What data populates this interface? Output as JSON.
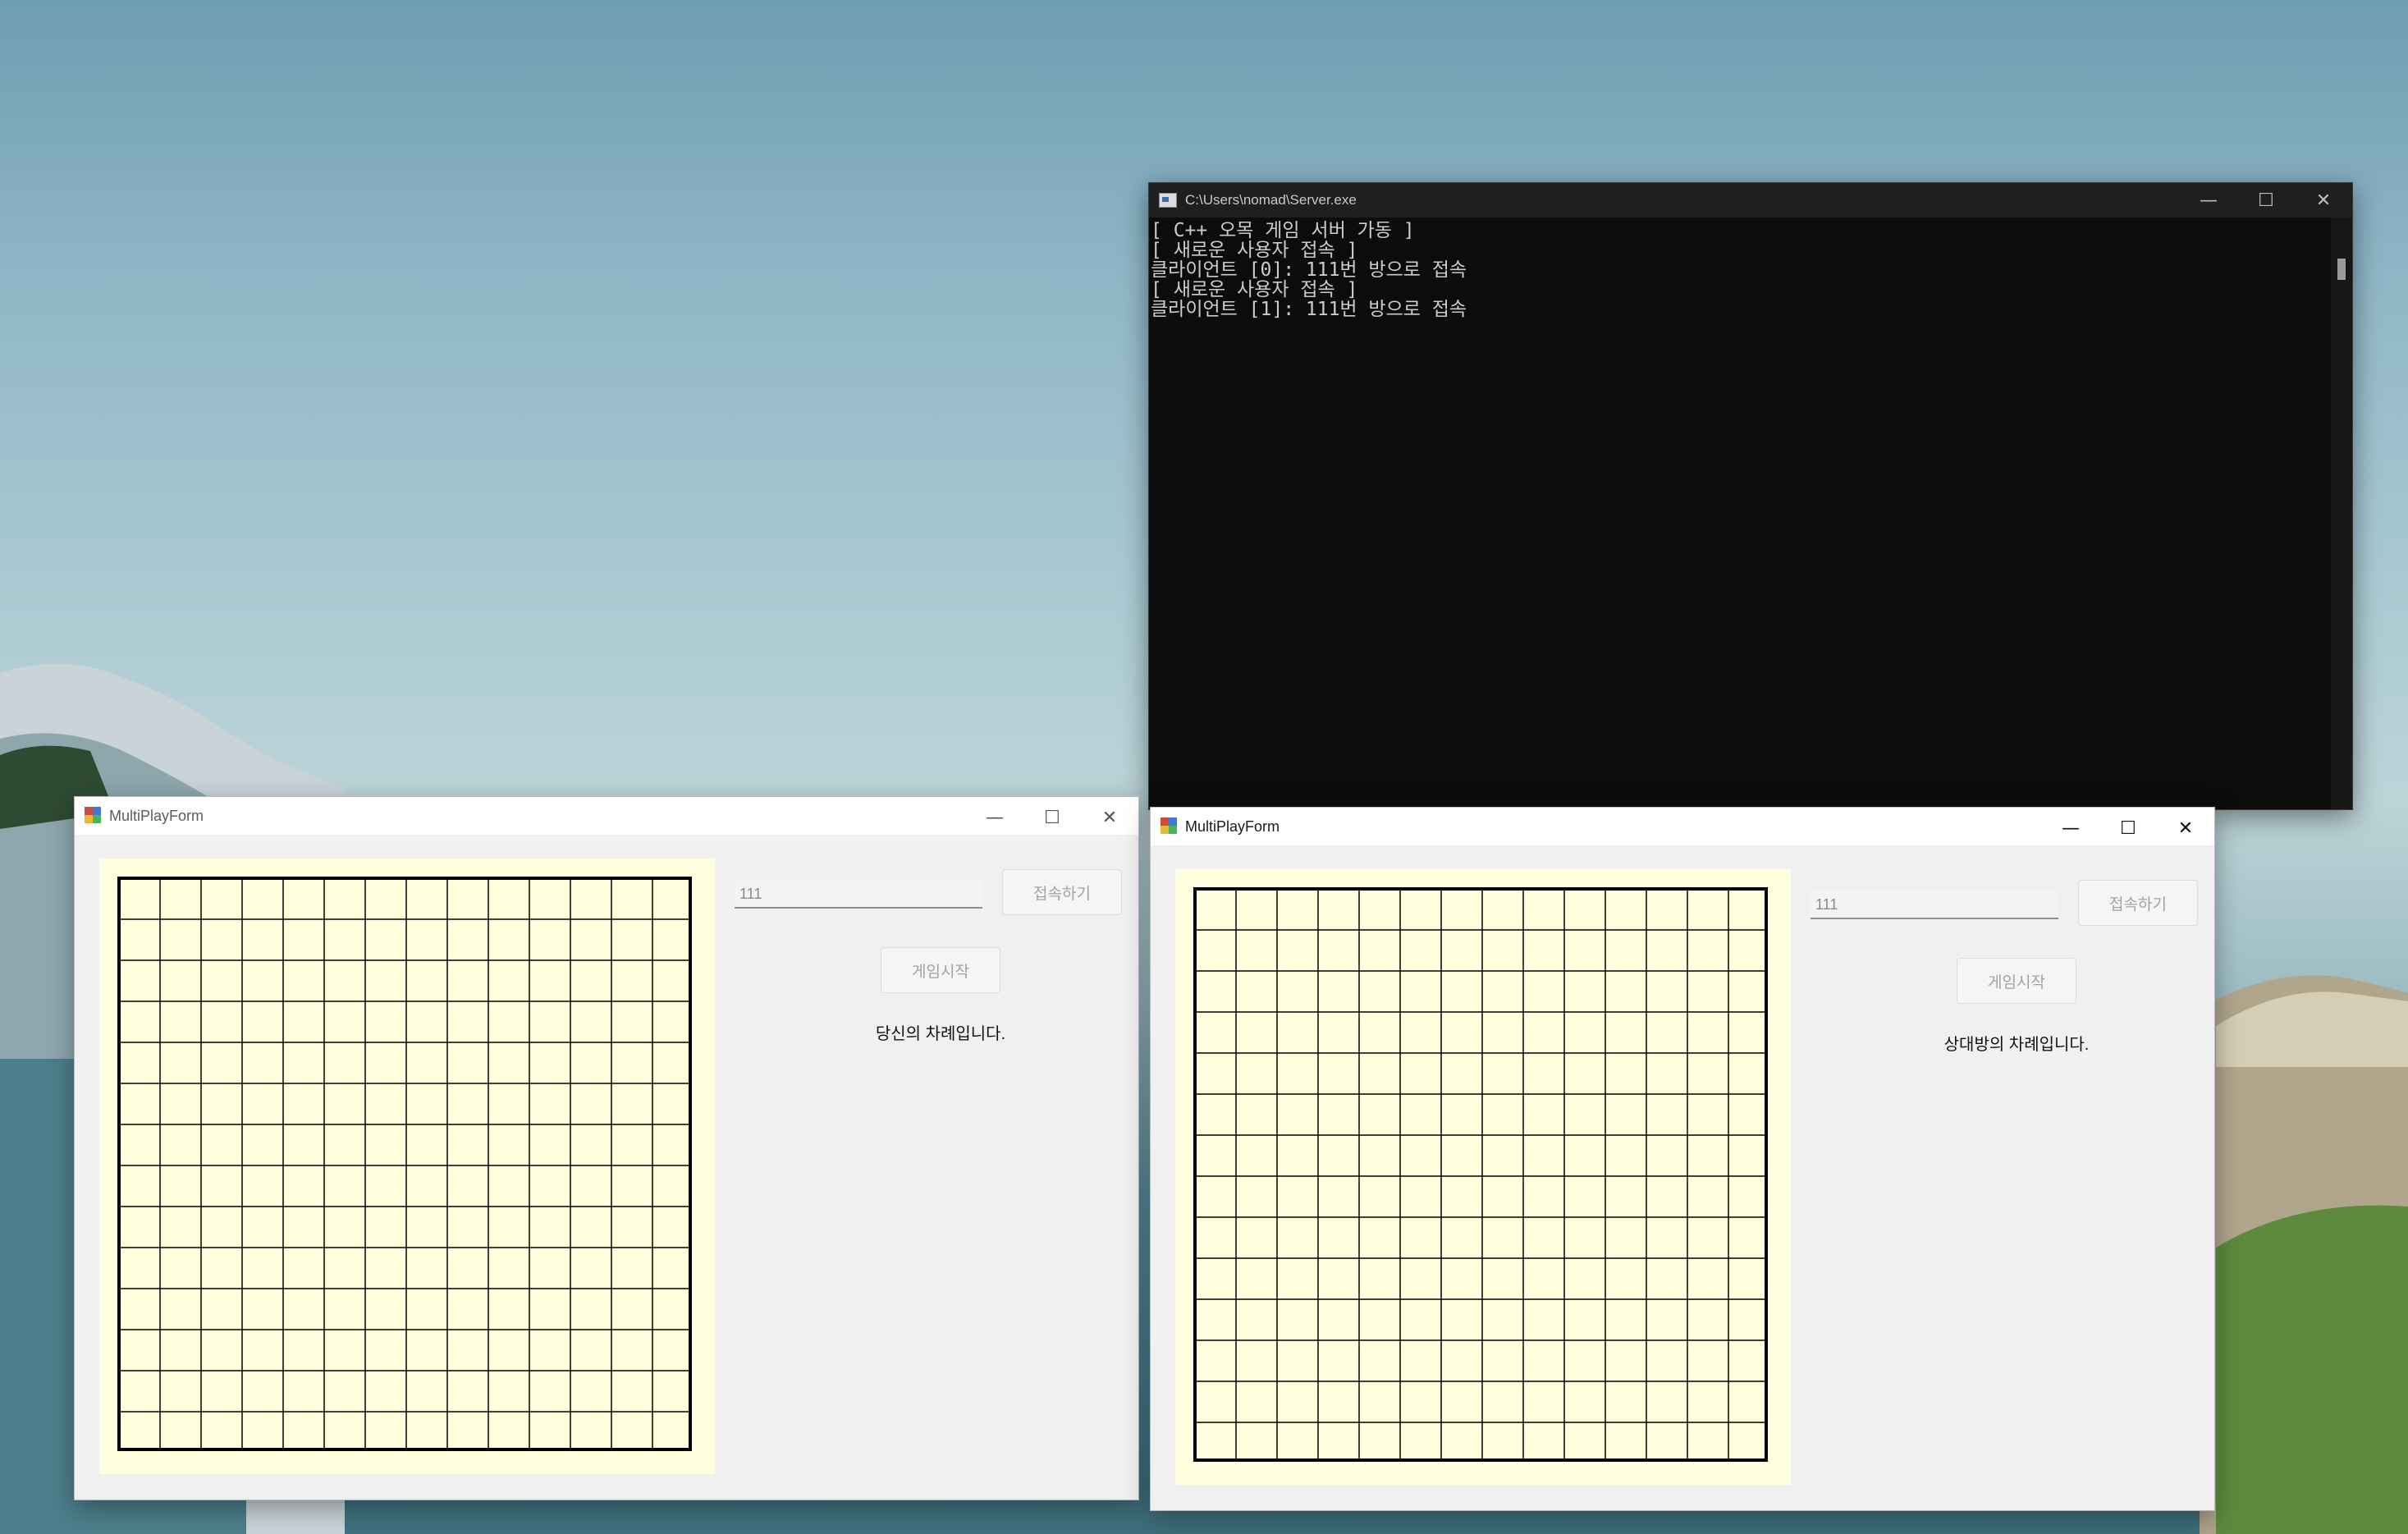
{
  "console": {
    "title": "C:\\Users\\nomad\\Server.exe",
    "lines": [
      "[ C++ 오목 게임 서버 가동 ]",
      "[ 새로운 사용자 접속 ]",
      "클라이언트 [0]: 111번 방으로 접속",
      "[ 새로운 사용자 접속 ]",
      "클라이언트 [1]: 111번 방으로 접속"
    ]
  },
  "window_controls": {
    "minimize": "—",
    "maximize": "☐",
    "close": "✕"
  },
  "forms": [
    {
      "title": "MultiPlayForm",
      "room_value": "111",
      "connect_label": "접속하기",
      "start_label": "게임시작",
      "status_text": "당신의 차례입니다."
    },
    {
      "title": "MultiPlayForm",
      "room_value": "111",
      "connect_label": "접속하기",
      "start_label": "게임시작",
      "status_text": "상대방의 차례입니다."
    }
  ],
  "board": {
    "cells": 14,
    "line_color": "#000000",
    "background": "#ffffe0"
  },
  "colors": {
    "console_bg": "#0c0c0c",
    "console_text": "#cccccc",
    "form_bg": "#f0f0f0"
  }
}
